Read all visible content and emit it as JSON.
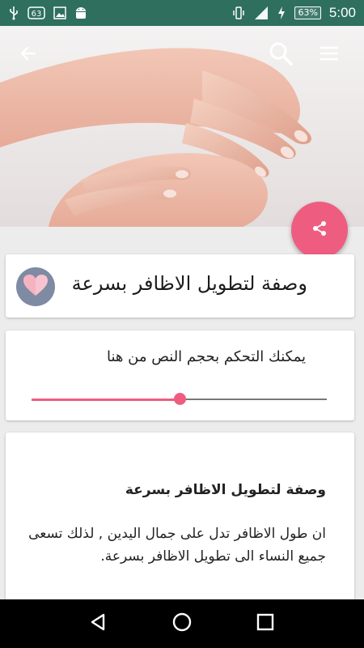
{
  "status_bar": {
    "icons_left": [
      "usb-icon",
      "sixty-three-notification-icon",
      "image-notification-icon",
      "android-icon"
    ],
    "icons_right": [
      "vibrate-icon",
      "signal-icon",
      "battery-charging-icon"
    ],
    "battery_percent": "63%",
    "time": "5:00",
    "background_color": "#2e6f5e"
  },
  "toolbar": {
    "back_icon": "back-arrow-icon",
    "search_icon": "search-icon",
    "menu_icon": "menu-icon"
  },
  "fab": {
    "icon": "share-icon",
    "color": "#ee5d80"
  },
  "title_card": {
    "title": "وصفة لتطويل الاظافر بسرعة",
    "favorite_icon": "heart-icon"
  },
  "text_size_card": {
    "label": "يمكنك التحكم بحجم النص من هنا",
    "slider_value_fraction": 0.5
  },
  "article": {
    "heading": "وصفة لتطويل الاظافر بسرعة",
    "body": "ان طول الاظافر تدل على جمال اليدين , لذلك تسعى جميع النساء الى تطويل الاظافر بسرعة."
  },
  "nav_bar": {
    "icons": [
      "nav-back-icon",
      "nav-home-icon",
      "nav-recents-icon"
    ]
  },
  "accent_color": "#ee5d80"
}
